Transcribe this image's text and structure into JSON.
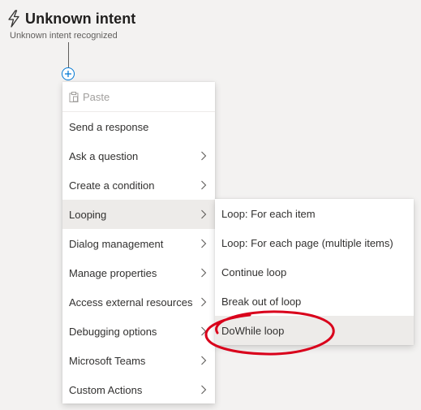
{
  "trigger": {
    "title": "Unknown intent",
    "subtitle": "Unknown intent recognized",
    "icon": "lightning-bolt-icon"
  },
  "add_button": {
    "icon": "plus-icon",
    "accent_color": "#0078d4"
  },
  "menu": {
    "paste_label": "Paste",
    "paste_icon": "clipboard-icon",
    "items": [
      {
        "label": "Send a response",
        "has_submenu": false
      },
      {
        "label": "Ask a question",
        "has_submenu": true
      },
      {
        "label": "Create a condition",
        "has_submenu": true
      },
      {
        "label": "Looping",
        "has_submenu": true,
        "active": true
      },
      {
        "label": "Dialog management",
        "has_submenu": true
      },
      {
        "label": "Manage properties",
        "has_submenu": true
      },
      {
        "label": "Access external resources",
        "has_submenu": true
      },
      {
        "label": "Debugging options",
        "has_submenu": true
      },
      {
        "label": "Microsoft Teams",
        "has_submenu": true
      },
      {
        "label": "Custom Actions",
        "has_submenu": true
      }
    ]
  },
  "submenu": {
    "items": [
      {
        "label": "Loop: For each item"
      },
      {
        "label": "Loop: For each page (multiple items)"
      },
      {
        "label": "Continue loop"
      },
      {
        "label": "Break out of loop"
      },
      {
        "label": "DoWhile loop",
        "hovered": true
      }
    ]
  },
  "annotation": {
    "shape": "ellipse",
    "color": "#d9001b",
    "highlights": "DoWhile loop"
  }
}
